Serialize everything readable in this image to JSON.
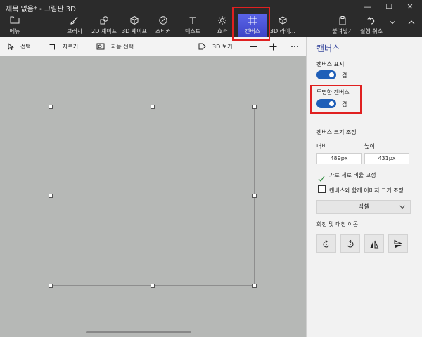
{
  "window": {
    "title": "제목 없음* - 그림판 3D",
    "minimize_glyph": "—",
    "maximize_glyph": "☐",
    "close_glyph": "✕"
  },
  "ribbon": {
    "menu_label": "메뉴",
    "tools": [
      {
        "label": "브러시",
        "icon": "brush-icon"
      },
      {
        "label": "2D 셰이프",
        "icon": "2d-shapes-icon"
      },
      {
        "label": "3D 셰이프",
        "icon": "3d-shapes-icon"
      },
      {
        "label": "스티커",
        "icon": "sticker-icon"
      },
      {
        "label": "텍스트",
        "icon": "text-icon"
      },
      {
        "label": "효과",
        "icon": "effects-icon"
      },
      {
        "label": "캔버스",
        "icon": "canvas-icon",
        "active": true
      },
      {
        "label": "3D 라이...",
        "icon": "3d-library-icon"
      }
    ],
    "paste_label": "붙여넣기",
    "undo_label": "실행 취소"
  },
  "subbar": {
    "select_label": "선택",
    "crop_label": "자르기",
    "magic_select_label": "자동 선택",
    "view3d_label": "3D 보기"
  },
  "panel": {
    "title": "캔버스",
    "show_canvas_label": "캔버스 표시",
    "show_canvas_state": "켬",
    "transparent_canvas_label": "투명한 캔버스",
    "transparent_canvas_state": "켬",
    "resize_section_label": "캔버스 크기 조정",
    "width_label": "너비",
    "height_label": "높이",
    "width_value": "489px",
    "height_value": "431px",
    "lock_aspect_label": "가로 세로 비율 고정",
    "resize_image_label": "캔버스와 함께 이미지 크기 조정",
    "unit_value": "픽셀",
    "rotate_section_label": "회전 및 대칭 이동"
  },
  "colors": {
    "accent": "#4a56d6",
    "toggle_on": "#1f5fb8",
    "highlight": "#e02020",
    "workspace": "#b6b8b6",
    "titlebar": "#2b2b2b"
  }
}
